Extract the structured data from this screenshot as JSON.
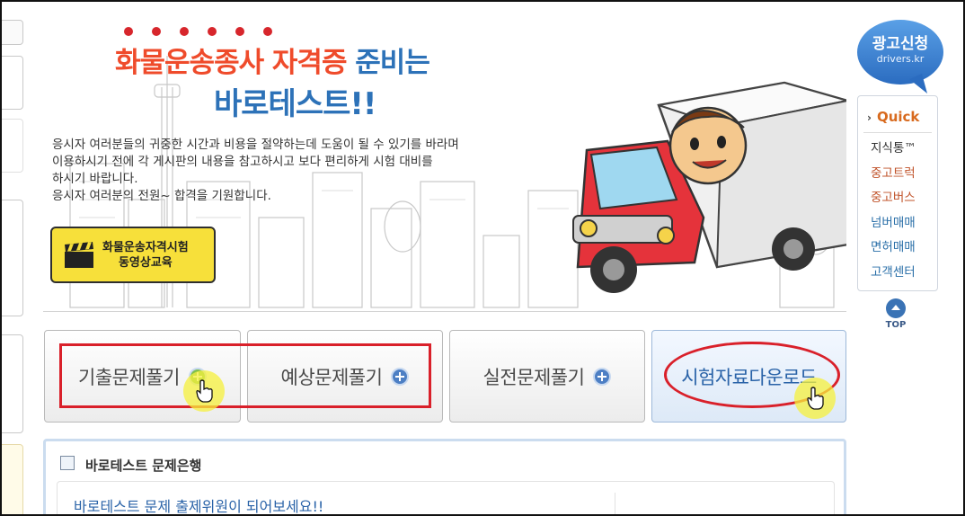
{
  "hero": {
    "title_red": "화물운송종사 자격증",
    "title_blue": "준비는",
    "title_line2": "바로테스트!!",
    "description": [
      "응시자 여러분들의 귀중한 시간과 비용을 절약하는데 도움이 될 수 있기를 바라며",
      "이용하시기  전에 각 게시판의 내용을 참고하시고 보다 편리하게  시험 대비를",
      "하시기 바랍니다.",
      "응시자 여러분의 전원~ 합격을 기원합니다."
    ],
    "video_button": {
      "line1": "화물운송자격시험",
      "line2": "동영상교육"
    }
  },
  "ad": {
    "title": "광고신청",
    "subtitle": "drivers.kr"
  },
  "quick_menu": {
    "heading": "Quick",
    "items": [
      {
        "label": "지식통™",
        "color": "#333333"
      },
      {
        "label": "중고트럭",
        "color": "#c0532a"
      },
      {
        "label": "중고버스",
        "color": "#c0532a"
      },
      {
        "label": "넘버매매",
        "color": "#2a6fa8"
      },
      {
        "label": "면허매매",
        "color": "#2a6fa8"
      },
      {
        "label": "고객센터",
        "color": "#2a6fa8"
      }
    ],
    "top_label": "TOP"
  },
  "quiz_buttons": [
    {
      "label": "기출문제풀기"
    },
    {
      "label": "예상문제풀기"
    },
    {
      "label": "실전문제풀기"
    },
    {
      "label": "시험자료다운로드"
    }
  ],
  "bank": {
    "title": "바로테스트 문제은행",
    "link": "바로테스트 문제 출제위원이 되어보세요!!"
  },
  "colors": {
    "accent_red": "#ef4b2b",
    "accent_blue": "#2d72b8",
    "annotation_red": "#d9202a",
    "highlight_yellow": "#f5f03c"
  }
}
